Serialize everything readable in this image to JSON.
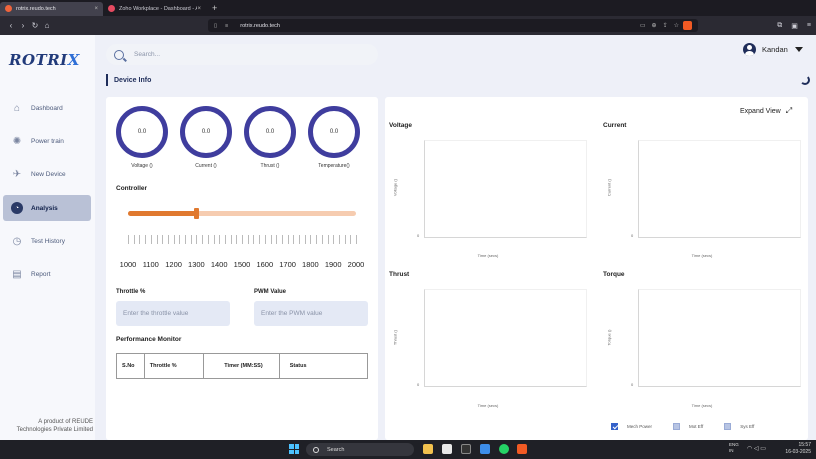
{
  "browser": {
    "tabs": [
      {
        "label": "rotrix.reudo.tech",
        "close": "×"
      },
      {
        "label": "Zoho Workplace - Dashboard - An ul",
        "close": "×"
      }
    ],
    "new_tab": "+",
    "url": "rotrix.reudo.tech"
  },
  "brand": {
    "logo_main": "ROTRI",
    "logo_accent": "X"
  },
  "sidebar": {
    "items": [
      {
        "label": "Dashboard",
        "icon": "home-icon"
      },
      {
        "label": "Power train",
        "icon": "power-train-icon"
      },
      {
        "label": "New Device",
        "icon": "new-device-icon"
      },
      {
        "label": "Analysis",
        "icon": "analysis-icon",
        "active": true
      },
      {
        "label": "Test History",
        "icon": "history-icon"
      },
      {
        "label": "Report",
        "icon": "report-icon"
      }
    ],
    "footer_line1": "A product of REUDE",
    "footer_line2": "Technologies Private Limited"
  },
  "search": {
    "placeholder": "Search..."
  },
  "user": {
    "name": "Kandan"
  },
  "page_title": "Device Info",
  "gauges": [
    {
      "value": "0.0",
      "label": "Voltage ()"
    },
    {
      "value": "0.0",
      "label": "Current ()"
    },
    {
      "value": "0.0",
      "label": "Thrust ()"
    },
    {
      "value": "0.0",
      "label": "Temperature()"
    }
  ],
  "controller": {
    "title": "Controller",
    "min": 1000,
    "max": 2000,
    "value": 1300,
    "scale_labels": [
      "1000",
      "1100",
      "1200",
      "1300",
      "1400",
      "1500",
      "1600",
      "1700",
      "1800",
      "1900",
      "2000"
    ]
  },
  "fields": {
    "throttle_label": "Throttle %",
    "throttle_placeholder": "Enter the throttle value",
    "pwm_label": "PWM Value",
    "pwm_placeholder": "Enter the PWM value"
  },
  "performance": {
    "title": "Performance Monitor",
    "columns": [
      "S.No",
      "Throttle %",
      "Timer (MM:SS)",
      "Status"
    ]
  },
  "charts_panel": {
    "expand_label": "Expand View",
    "charts": [
      {
        "title": "Voltage",
        "ylabel": "Voltage ()",
        "xlabel": "Time (secs)",
        "zero": "0"
      },
      {
        "title": "Current",
        "ylabel": "Current ()",
        "xlabel": "Time (secs)",
        "zero": "0"
      },
      {
        "title": "Thrust",
        "ylabel": "Thrust ()",
        "xlabel": "Time (secs)",
        "zero": "0"
      },
      {
        "title": "Torque",
        "ylabel": "Torque ()",
        "xlabel": "Time (secs)",
        "zero": "0"
      }
    ],
    "legend": [
      {
        "label": "Mech Power",
        "checked": true
      },
      {
        "label": "Mot Eff",
        "checked": false
      },
      {
        "label": "Sys Eff",
        "checked": false
      }
    ]
  },
  "taskbar": {
    "search_placeholder": "Search",
    "lang1": "ENG",
    "lang2": "IN",
    "time": "15:57",
    "date": "16-03-2025"
  }
}
